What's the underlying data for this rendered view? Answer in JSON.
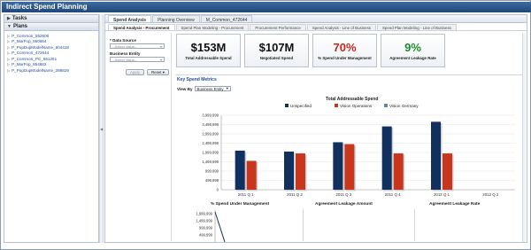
{
  "app": {
    "title": "Indirect Spend Planning"
  },
  "navigator": {
    "sections": [
      {
        "label": "Tasks"
      },
      {
        "label": "Plans"
      }
    ],
    "plans": [
      "P_Common_552606",
      "P_MarFop_550684",
      "P_PopDupModelName_604428",
      "P_Common_472644",
      "P_Common_PC_651261",
      "P_MarFop_854682",
      "P_PopDupModelName_298829"
    ]
  },
  "tabs": [
    "Spend Analysis",
    "Planning Overview",
    "M_Common_472644"
  ],
  "subtabs": [
    "Spend Analysis - Procurement",
    "Spend Plan Modeling - Procurement",
    "Procurement Performance",
    "Spend Analysis - Line of Business",
    "Spend Plan Modeling - Line of Business"
  ],
  "filters": {
    "data_source_label": "* Data Source",
    "data_source_placeholder": "--Select Value--",
    "business_entity_label": "Business Entity",
    "business_entity_placeholder": "--Select Value--",
    "apply_label": "Apply",
    "reset_label": "Reset"
  },
  "kpis": [
    {
      "value": "$153M",
      "label": "Total Addressable Spend",
      "color": "#111111"
    },
    {
      "value": "$107M",
      "label": "Negotiated Spend",
      "color": "#111111"
    },
    {
      "value": "70%",
      "label": "% Spend Under Management",
      "color": "#c8261b"
    },
    {
      "value": "9%",
      "label": "Agreement Leakage Rate",
      "color": "#1f8c2b"
    }
  ],
  "metrics": {
    "title": "Key Spend Metrics",
    "view_by_label": "View By",
    "view_by_value": "Business Entity",
    "bottom_titles": [
      "% Spend Under Management",
      "Agreement Leakage Amount",
      "Agreement Leakage Rate"
    ],
    "bottom_ticks": [
      "1,999,999",
      "1,499,999",
      "999,999",
      "499,999"
    ]
  },
  "chart_data": {
    "type": "bar",
    "title": "Total Addressable Spend",
    "categories": [
      "2011 Q 1",
      "2011 Q 2",
      "2011 Q 3",
      "2011 Q 4",
      "2012 Q 1",
      "2012 Q 2"
    ],
    "series": [
      {
        "name": "Unspecified",
        "color": "#12305e",
        "values": [
          2100000,
          2050000,
          2550000,
          3400000,
          3650000,
          0
        ]
      },
      {
        "name": "Vision Operations",
        "color": "#c8361d",
        "values": [
          1550000,
          1950000,
          2450000,
          1950000,
          1950000,
          0
        ]
      },
      {
        "name": "Vision Germany",
        "color": "#6f7fa0",
        "values": [
          0,
          0,
          0,
          0,
          0,
          0
        ]
      }
    ],
    "y_ticks": [
      "3,999,999",
      "3,499,999",
      "2,999,999",
      "2,499,999",
      "1,999,999",
      "1,499,999",
      "999,999",
      "499,999",
      "0"
    ],
    "ylim": [
      0,
      4000000
    ]
  }
}
